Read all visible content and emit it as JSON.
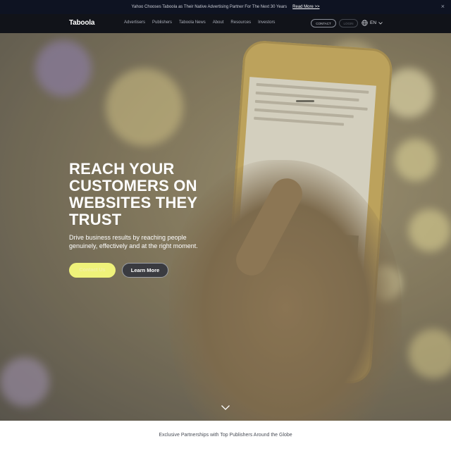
{
  "announcement": {
    "text": "Yahoo Chooses Taboola as Their Native Advertising Partner For The Next 30 Years",
    "link_label": "Read More >>",
    "close_icon": "close-icon"
  },
  "nav": {
    "logo": "Taboola",
    "items": [
      {
        "label": "Advertisers"
      },
      {
        "label": "Publishers"
      },
      {
        "label": "Taboola News"
      },
      {
        "label": "About"
      },
      {
        "label": "Resources"
      },
      {
        "label": "Investors"
      }
    ],
    "contact_label": "CONTACT",
    "login_label": "LOGIN",
    "language": "EN",
    "globe_icon": "globe-icon"
  },
  "hero": {
    "headline": "REACH YOUR CUSTOMERS ON WEBSITES THEY TRUST",
    "subtext": "Drive business results by reaching people genuinely, effectively and at the right moment.",
    "primary_button": "Contact Us",
    "secondary_button": "Learn More",
    "scroll_icon": "chevron-down-icon"
  },
  "partners": {
    "heading": "Exclusive Partnerships with Top Publishers Around the Globe"
  },
  "colors": {
    "announcement_bg": "#0e1322",
    "nav_bg": "#111319",
    "primary_button": "#eff27a",
    "secondary_button_border": "#9c9fa6"
  }
}
